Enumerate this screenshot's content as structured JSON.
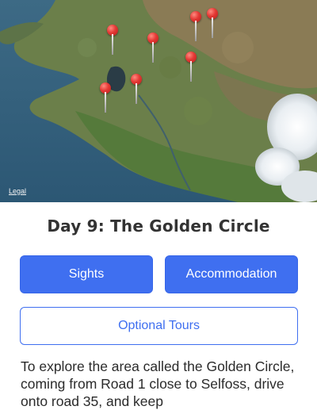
{
  "map": {
    "legal_label": "Legal",
    "pins": [
      {
        "name": "sight-1"
      },
      {
        "name": "sight-2"
      },
      {
        "name": "sight-3"
      },
      {
        "name": "sight-4"
      },
      {
        "name": "sight-5"
      },
      {
        "name": "sight-6"
      },
      {
        "name": "sight-7"
      }
    ]
  },
  "page": {
    "title": "Day 9: The Golden Circle"
  },
  "buttons": {
    "sights": "Sights",
    "accommodation": "Accommodation",
    "optional_tours": "Optional Tours"
  },
  "description": {
    "text": "To explore the area called the Golden Circle, coming from Road 1 close to Selfoss, drive onto road 35, and keep"
  },
  "colors": {
    "accent": "#3f6ff0",
    "pin": "#e53935",
    "title_text": "#333333"
  }
}
